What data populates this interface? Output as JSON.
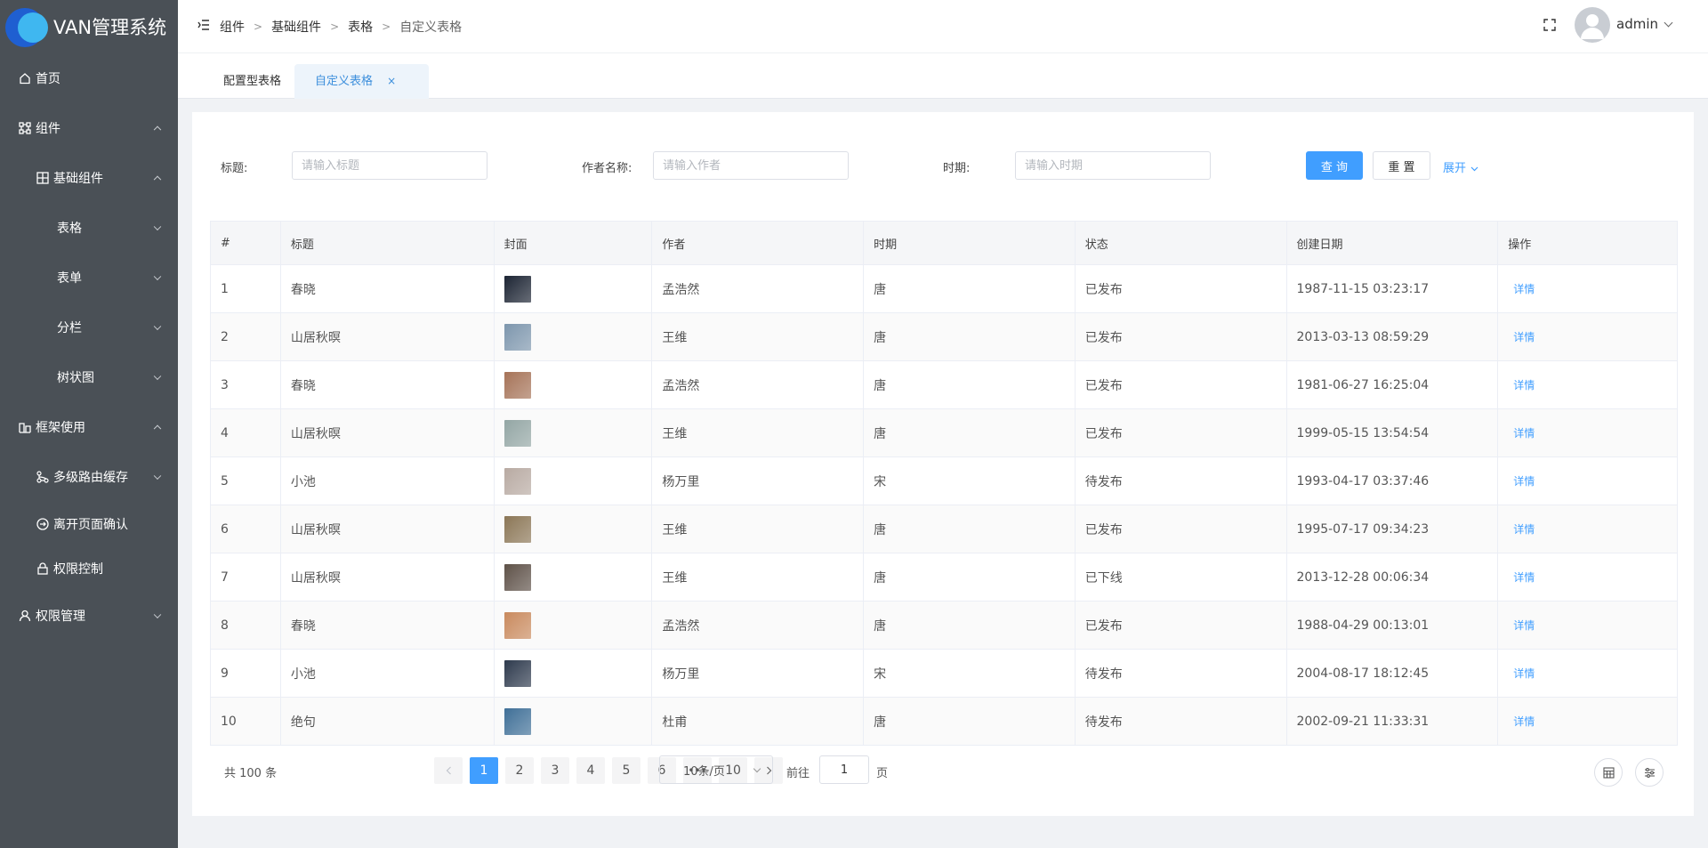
{
  "app": {
    "title": "VAN管理系统"
  },
  "sidebar": {
    "items": [
      {
        "label": "首页",
        "icon": "home-icon"
      },
      {
        "label": "组件",
        "icon": "component-icon"
      },
      {
        "label": "基础组件",
        "icon": "grid-icon"
      },
      {
        "label": "表格"
      },
      {
        "label": "表单"
      },
      {
        "label": "分栏"
      },
      {
        "label": "树状图"
      },
      {
        "label": "框架使用",
        "icon": "framework-icon"
      },
      {
        "label": "多级路由缓存",
        "icon": "route-icon"
      },
      {
        "label": "离开页面确认",
        "icon": "leave-icon"
      },
      {
        "label": "权限控制",
        "icon": "lock-icon"
      },
      {
        "label": "权限管理",
        "icon": "user-icon"
      }
    ]
  },
  "header": {
    "breadcrumb": [
      "组件",
      "基础组件",
      "表格",
      "自定义表格"
    ],
    "username": "admin"
  },
  "tabs": [
    {
      "label": "配置型表格"
    },
    {
      "label": "自定义表格",
      "close": "×",
      "active": true
    }
  ],
  "filters": {
    "title_label": "标题:",
    "title_placeholder": "请输入标题",
    "author_label": "作者名称:",
    "author_placeholder": "请输入作者",
    "period_label": "时期:",
    "period_placeholder": "请输入时期",
    "search_label": "查 询",
    "reset_label": "重 置",
    "expand_label": "展开"
  },
  "table": {
    "columns": [
      "#",
      "标题",
      "封面",
      "作者",
      "时期",
      "状态",
      "创建日期",
      "操作"
    ],
    "action_label": "详情",
    "rows": [
      {
        "no": "1",
        "title": "春晓",
        "author": "孟浩然",
        "period": "唐",
        "status": "已发布",
        "created": "1987-11-15 03:23:17",
        "cover": "#1c2433"
      },
      {
        "no": "2",
        "title": "山居秋暝",
        "author": "王维",
        "period": "唐",
        "status": "已发布",
        "created": "2013-03-13 08:59:29",
        "cover": "#7d96ad"
      },
      {
        "no": "3",
        "title": "春晓",
        "author": "孟浩然",
        "period": "唐",
        "status": "已发布",
        "created": "1981-06-27 16:25:04",
        "cover": "#a67358"
      },
      {
        "no": "4",
        "title": "山居秋暝",
        "author": "王维",
        "period": "唐",
        "status": "已发布",
        "created": "1999-05-15 13:54:54",
        "cover": "#93a6a4"
      },
      {
        "no": "5",
        "title": "小池",
        "author": "杨万里",
        "period": "宋",
        "status": "待发布",
        "created": "1993-04-17 03:37:46",
        "cover": "#b8aaa2"
      },
      {
        "no": "6",
        "title": "山居秋暝",
        "author": "王维",
        "period": "唐",
        "status": "已发布",
        "created": "1995-07-17 09:34:23",
        "cover": "#8b7656"
      },
      {
        "no": "7",
        "title": "山居秋暝",
        "author": "王维",
        "period": "唐",
        "status": "已下线",
        "created": "2013-12-28 00:06:34",
        "cover": "#5e5148"
      },
      {
        "no": "8",
        "title": "春晓",
        "author": "孟浩然",
        "period": "唐",
        "status": "已发布",
        "created": "1988-04-29 00:13:01",
        "cover": "#c98a5e"
      },
      {
        "no": "9",
        "title": "小池",
        "author": "杨万里",
        "period": "宋",
        "status": "待发布",
        "created": "2004-08-17 18:12:45",
        "cover": "#2e3a4d"
      },
      {
        "no": "10",
        "title": "绝句",
        "author": "杜甫",
        "period": "唐",
        "status": "待发布",
        "created": "2002-09-21 11:33:31",
        "cover": "#3f6f97"
      }
    ]
  },
  "pagination": {
    "total_text": "共 100 条",
    "pages": [
      "1",
      "2",
      "3",
      "4",
      "5",
      "6",
      "•••",
      "10"
    ],
    "current": "1",
    "page_size": "10条/页",
    "goto_prefix": "前往",
    "goto_value": "1",
    "goto_suffix": "页"
  },
  "colors": {
    "sidebar_bg": "#4a5056",
    "primary": "#409eff"
  }
}
